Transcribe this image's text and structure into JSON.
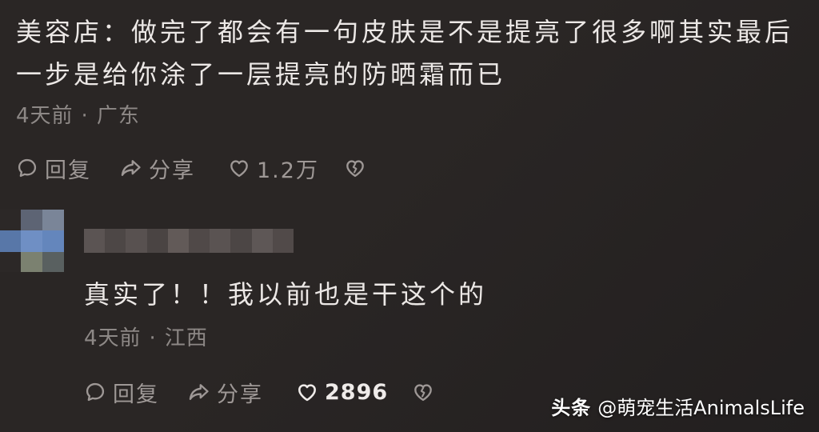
{
  "theme": {
    "bg": "#2a2625",
    "text": "#ece8e6",
    "muted": "#8d8886",
    "icon": "#9e9896",
    "highlight": "#efebe9"
  },
  "icons": {
    "reply": "comment-bubble-icon",
    "share": "share-arrow-icon",
    "like": "heart-icon",
    "dislike": "broken-heart-icon"
  },
  "comment": {
    "text": "美容店：做完了都会有一句皮肤是不是提亮了很多啊其实最后一步是给你涂了一层提亮的防晒霜而已",
    "time": "4天前",
    "separator": "·",
    "location": "广东",
    "actions": {
      "reply_label": "回复",
      "share_label": "分享",
      "like_count": "1.2万"
    }
  },
  "reply": {
    "text": "真实了！！我以前也是干这个的",
    "time": "4天前",
    "separator": "·",
    "location": "江西",
    "actions": {
      "reply_label": "回复",
      "share_label": "分享",
      "like_count": "2896"
    }
  },
  "watermark": {
    "platform": "头条",
    "account": "@萌宠生活AnimalsLife"
  }
}
